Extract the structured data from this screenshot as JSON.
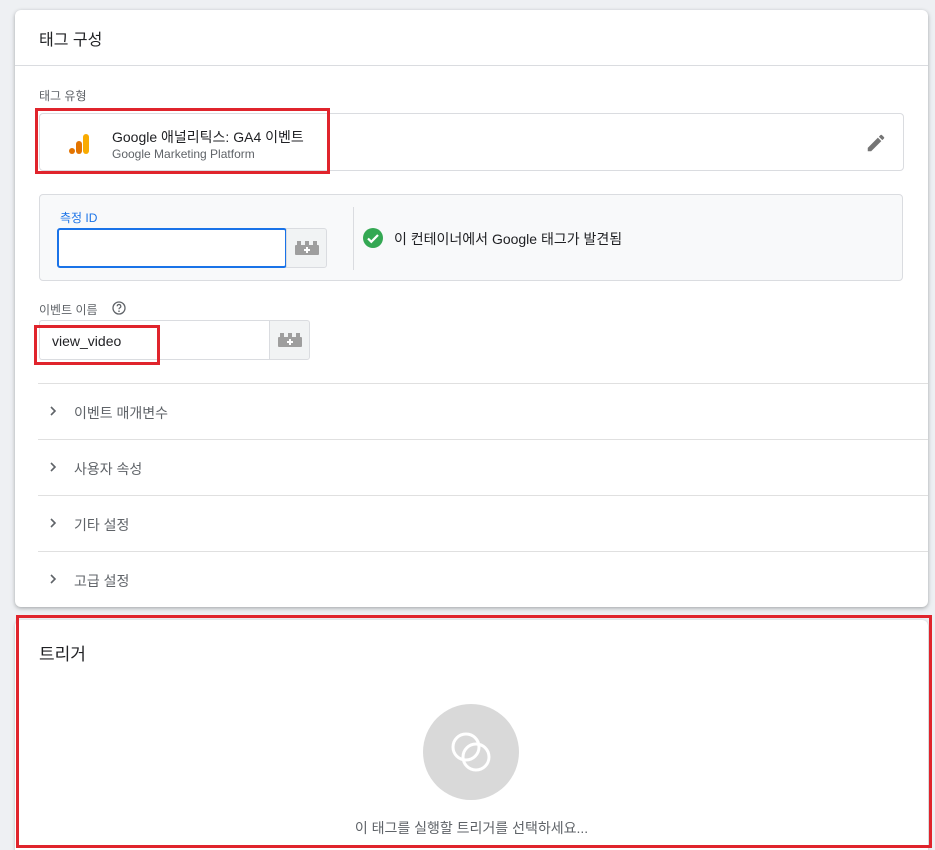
{
  "tag_config": {
    "title": "태그 구성",
    "tag_type_label": "태그 유형",
    "tag_type": {
      "name": "Google 애널리틱스: GA4 이벤트",
      "platform": "Google Marketing Platform",
      "icon": "google-analytics-icon"
    },
    "measurement": {
      "label": "측정 ID",
      "value": "",
      "status_text": "이 컨테이너에서 Google 태그가 발견됨"
    },
    "event_name": {
      "label": "이벤트 이름",
      "value": "view_video"
    },
    "sections": [
      {
        "label": "이벤트 매개변수"
      },
      {
        "label": "사용자 속성"
      },
      {
        "label": "기타 설정"
      },
      {
        "label": "고급 설정"
      }
    ]
  },
  "trigger": {
    "title": "트리거",
    "hint": "이 태그를 실행할 트리거를 선택하세요..."
  },
  "colors": {
    "accent": "#1a73e8",
    "success": "#34a853",
    "highlight": "#e0242c",
    "ga_orange": "#f9ab00",
    "ga_dark": "#e37400"
  }
}
